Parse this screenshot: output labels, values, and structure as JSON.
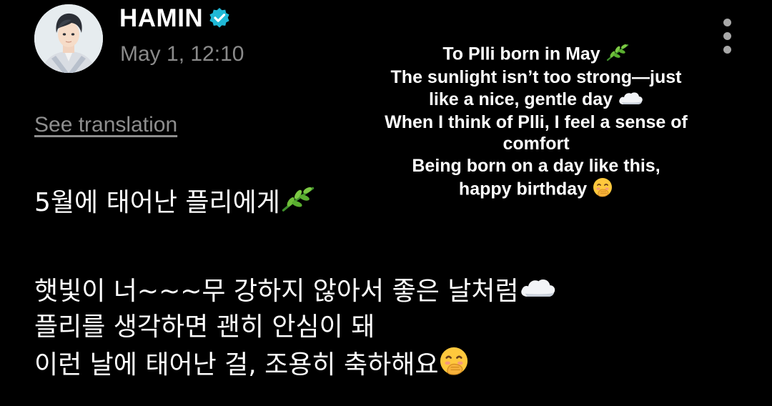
{
  "post": {
    "author": {
      "name": "HAMIN",
      "avatar_icon": "avatar-illustration",
      "verified_icon": "verified-badge-icon",
      "verified_color": "#1fb8d6"
    },
    "timestamp": "May 1, 12:10",
    "menu_icon": "more-vertical-icon",
    "see_translation": "See translation",
    "body_lines": [
      "5월에 태어난 플리에게",
      "햇빛이 너~~~무 강하지 않아서 좋은 날처럼",
      "플리를 생각하면 괜히 안심이 돼",
      "이런 날에 태어난 걸, 조용히 축하해요"
    ],
    "body_emojis": [
      "herb-emoji",
      "cloud-emoji",
      "hand-over-mouth-emoji"
    ]
  },
  "translation_overlay": {
    "lines": [
      "To Plli born in May",
      "The sunlight isn’t too strong—just",
      "like a nice, gentle day",
      "When I think of Plli, I feel a sense of",
      "comfort",
      "Being born on a day like this,",
      "happy birthday"
    ],
    "emojis": [
      "herb-emoji",
      "cloud-emoji",
      "hand-over-mouth-emoji"
    ]
  },
  "colors": {
    "background": "#000000",
    "text": "#ffffff",
    "muted_text": "#8a8a8a",
    "menu_dots": "#a8a8a8"
  }
}
